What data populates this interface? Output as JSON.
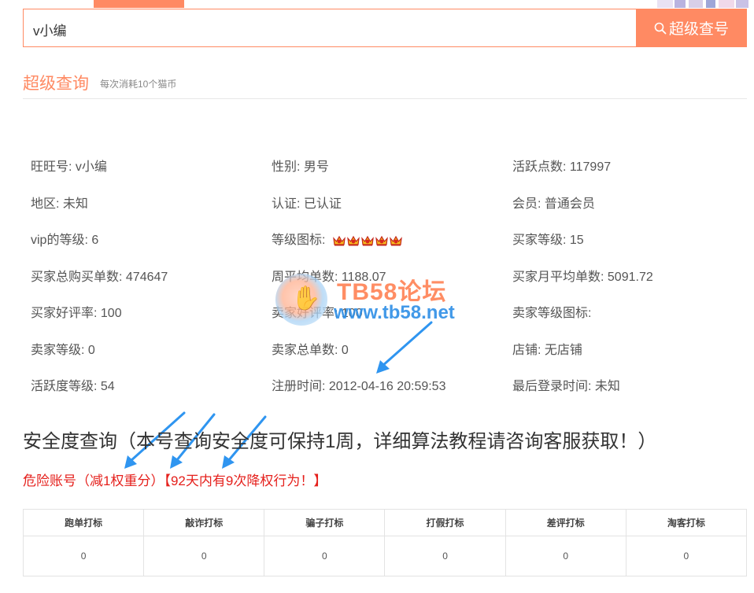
{
  "search": {
    "value": "v小编",
    "button_label": "超级查号"
  },
  "section": {
    "title": "超级查询",
    "subtitle": "每次消耗10个猫币"
  },
  "info": {
    "wangwang_label": "旺旺号:",
    "wangwang_value": "v小编",
    "gender_label": "性别:",
    "gender_value": "男号",
    "active_points_label": "活跃点数:",
    "active_points_value": "117997",
    "region_label": "地区:",
    "region_value": "未知",
    "auth_label": "认证:",
    "auth_value": "已认证",
    "member_label": "会员:",
    "member_value": "普通会员",
    "vip_label": "vip的等级:",
    "vip_value": "6",
    "level_icon_label": "等级图标:",
    "level_icon_crowns": 5,
    "buyer_level_label": "买家等级:",
    "buyer_level_value": "15",
    "buyer_total_label": "买家总购买单数:",
    "buyer_total_value": "474647",
    "weekly_avg_label": "周平均单数:",
    "weekly_avg_value": "1188.07",
    "buyer_monthly_label": "买家月平均单数:",
    "buyer_monthly_value": "5091.72",
    "buyer_rate_label": "买家好评率:",
    "buyer_rate_value": "100",
    "seller_rate_label": "卖家好评率:",
    "seller_rate_value": "100",
    "seller_level_icon_label": "卖家等级图标:",
    "seller_level_label": "卖家等级:",
    "seller_level_value": "0",
    "seller_total_label": "卖家总单数:",
    "seller_total_value": "0",
    "shop_label": "店铺:",
    "shop_value": "无店铺",
    "activity_level_label": "活跃度等级:",
    "activity_level_value": "54",
    "register_label": "注册时间:",
    "register_value": "2012-04-16 20:59:53",
    "last_login_label": "最后登录时间:",
    "last_login_value": "未知"
  },
  "watermark": {
    "title": "TB58论坛",
    "url": "www.tb58.net"
  },
  "safety": {
    "title": "安全度查询（本号查询安全度可保持1周，详细算法教程请咨询客服获取！）",
    "danger": "危险账号（减1权重分）【92天内有9次降权行为！】"
  },
  "marks_table": {
    "headers": [
      "跑单打标",
      "敲诈打标",
      "骗子打标",
      "打假打标",
      "差评打标",
      "淘客打标"
    ],
    "values": [
      "0",
      "0",
      "0",
      "0",
      "0",
      "0"
    ]
  },
  "colors": {
    "accent": "#ff8a63",
    "danger": "#e5201c",
    "watermark_blue": "#2e8fe6",
    "arrow_blue": "#2f95f0"
  }
}
